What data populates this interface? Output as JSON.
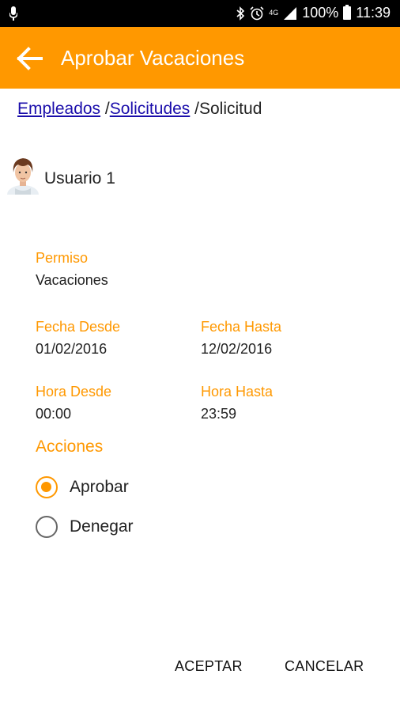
{
  "status_bar": {
    "battery": "100%",
    "time": "11:39",
    "network": "4G",
    "icons": [
      "mic-icon",
      "bluetooth-icon",
      "alarm-icon",
      "signal-icon",
      "battery-icon"
    ]
  },
  "app_bar": {
    "title": "Aprobar Vacaciones",
    "back_icon": "arrow-back-icon",
    "color": "#ff9800"
  },
  "breadcrumb": {
    "items": [
      {
        "label": "Empleados",
        "link": true
      },
      {
        "label": "Solicitudes",
        "link": true
      },
      {
        "label": "Solicitud",
        "link": false
      }
    ],
    "separator": "/"
  },
  "user": {
    "name": "Usuario 1"
  },
  "details": {
    "permiso_label": "Permiso",
    "permiso_value": "Vacaciones",
    "fecha_desde_label": "Fecha Desde",
    "fecha_desde_value": "01/02/2016",
    "fecha_hasta_label": "Fecha Hasta",
    "fecha_hasta_value": "12/02/2016",
    "hora_desde_label": "Hora Desde",
    "hora_desde_value": "00:00",
    "hora_hasta_label": "Hora Hasta",
    "hora_hasta_value": "23:59"
  },
  "actions": {
    "title": "Acciones",
    "options": [
      {
        "label": "Aprobar",
        "selected": true
      },
      {
        "label": "Denegar",
        "selected": false
      }
    ]
  },
  "buttons": {
    "accept": "ACEPTAR",
    "cancel": "CANCELAR"
  },
  "colors": {
    "accent": "#ff9800",
    "link": "#1a0dab"
  }
}
